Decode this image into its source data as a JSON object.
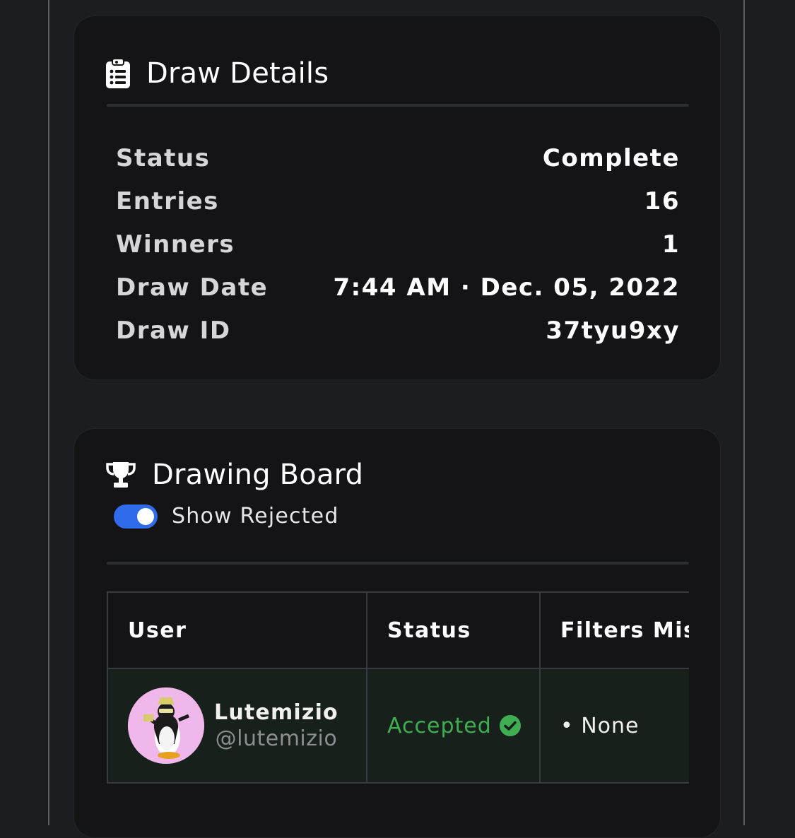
{
  "draw_details": {
    "title": "Draw Details",
    "icon": "clipboard-list-icon",
    "rows": [
      {
        "label": "Status",
        "value": "Complete"
      },
      {
        "label": "Entries",
        "value": "16"
      },
      {
        "label": "Winners",
        "value": "1"
      },
      {
        "label": "Draw Date",
        "value": "7:44 AM · Dec. 05, 2022"
      },
      {
        "label": "Draw ID",
        "value": "37tyu9xy"
      }
    ]
  },
  "drawing_board": {
    "title": "Drawing Board",
    "icon": "trophy-icon",
    "toggle": {
      "label": "Show Rejected",
      "on": true
    },
    "table": {
      "columns": [
        "User",
        "Status",
        "Filters Missed"
      ],
      "rows": [
        {
          "name": "Lutemizio",
          "handle": "@lutemizio",
          "status": "Accepted",
          "filters": "• None"
        }
      ]
    }
  },
  "colors": {
    "background": "#1c1d20",
    "card": "#141416",
    "accent_toggle": "#2f6bea",
    "accepted": "#3fae52",
    "row_bg": "#17201a"
  }
}
